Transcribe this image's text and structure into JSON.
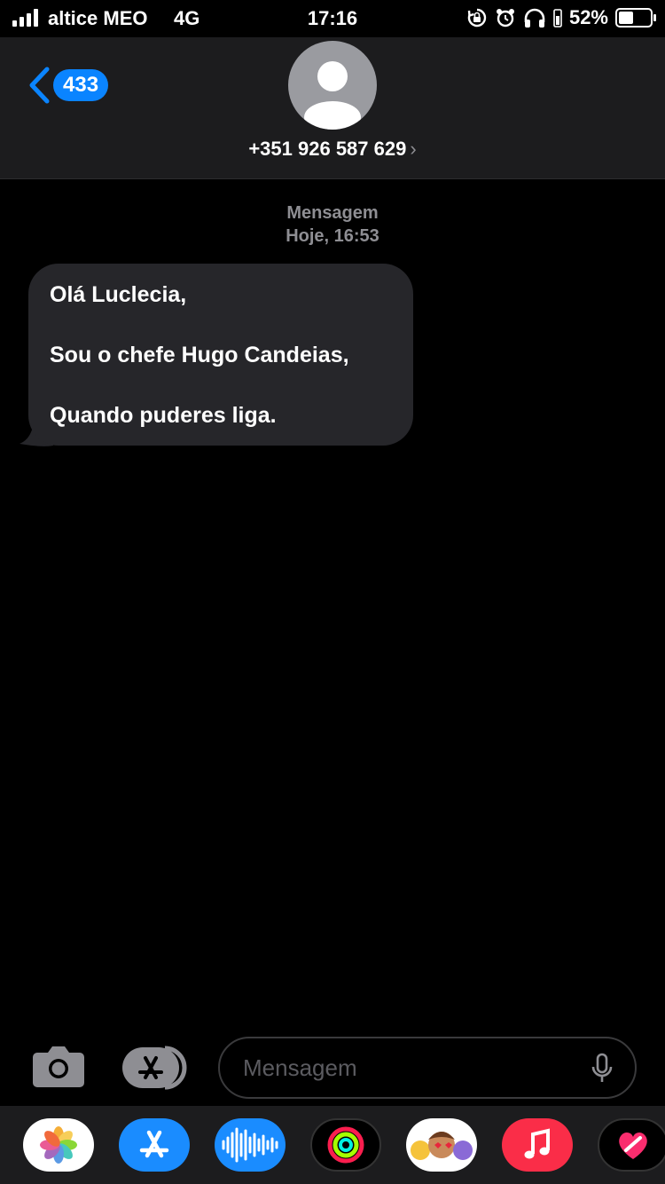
{
  "status_bar": {
    "carrier": "altice MEO",
    "network": "4G",
    "time": "17:16",
    "battery_percent_text": "52%",
    "battery_level": 0.52,
    "icons": [
      "rotation-lock-icon",
      "alarm-icon",
      "headphones-icon"
    ]
  },
  "header": {
    "back_count": "433",
    "contact_number": "+351 926 587 629",
    "contact_chevron": "›"
  },
  "conversation": {
    "service_label": "Mensagem",
    "date_label": "Hoje, 16:53",
    "messages": [
      {
        "direction": "incoming",
        "lines": [
          "Olá Luclecia,",
          "Sou o chefe  Hugo Candeias,",
          "Quando puderes liga."
        ]
      }
    ]
  },
  "compose": {
    "placeholder": "Mensagem"
  },
  "app_drawer": {
    "apps": [
      "photos-icon",
      "app-store-icon",
      "audio-message-icon",
      "activity-icon",
      "memoji-icon",
      "music-icon",
      "heart-app-icon"
    ]
  },
  "colors": {
    "accent": "#0a84ff",
    "header_bg": "#1c1c1e",
    "bubble_bg": "#26262a",
    "muted": "#8e8e93"
  }
}
